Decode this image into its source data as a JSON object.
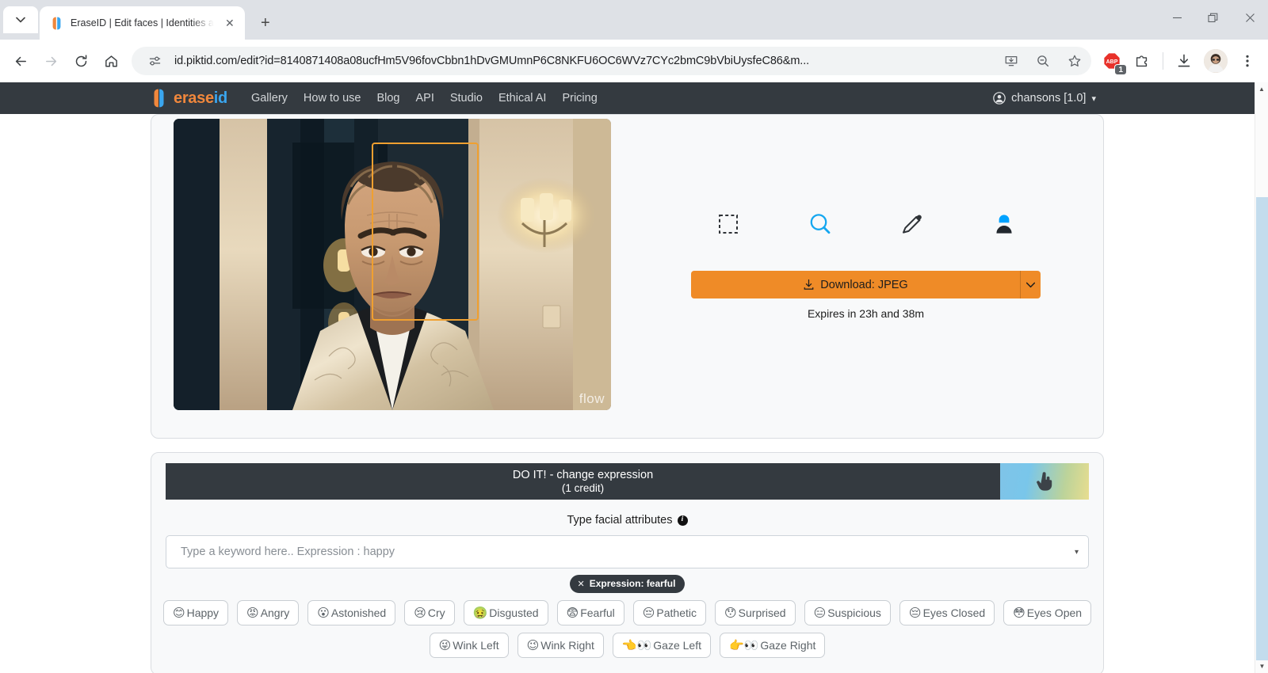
{
  "browser": {
    "tab": {
      "title": "EraseID | Edit faces | Identities a",
      "favicon": "eraseid-logo-icon",
      "close_label": "✕"
    },
    "new_tab_label": "+",
    "window": {
      "minimize": "—",
      "maximize": "❐",
      "close": "✕"
    },
    "nav": {
      "back": "back-arrow-icon",
      "forward": "forward-arrow-icon",
      "reload": "reload-icon",
      "home": "home-icon"
    },
    "omnibox": {
      "url": "id.piktid.com/edit?id=8140871408a08ucfHm5V96fovCbbn1hDvGMUmnP6C8NKFU6OC6WVz7CYc2bmC9bVbiUysfeC86&m...",
      "site_info": "tune-icon",
      "install": "install-app-icon",
      "zoom": "zoom-out-icon",
      "bookmark": "star-icon"
    },
    "extensions": {
      "adblock": "adblock-icon",
      "adblock_badge": "1",
      "puzzle": "extensions-icon",
      "downloads": "downloads-icon",
      "profile": "profile-avatar",
      "menu": "three-dot-menu-icon"
    }
  },
  "site_header": {
    "brand": {
      "prefix": "erase",
      "suffix": "id"
    },
    "nav_items": [
      "Gallery",
      "How to use",
      "Blog",
      "API",
      "Studio",
      "Ethical AI",
      "Pricing"
    ],
    "account": "chansons [1.0]",
    "account_caret": "▾"
  },
  "preview": {
    "watermark": "flow",
    "tools": [
      {
        "name": "select-region",
        "icon": "dashed-square-icon"
      },
      {
        "name": "zoom-search",
        "icon": "magnifier-icon"
      },
      {
        "name": "edit-pencil",
        "icon": "pencil-icon"
      },
      {
        "name": "identity-person",
        "icon": "person-icon"
      }
    ],
    "download_label": "Download: JPEG",
    "download_icon": "download-icon",
    "download_caret": "▾",
    "expires": "Expires in 23h and 38m"
  },
  "controls": {
    "doit_main": "DO IT! - change expression",
    "doit_sub": "(1 credit)",
    "doit_cursor_icon": "pointing-hand-icon",
    "attributes_label": "Type facial attributes",
    "info_icon": "i",
    "keyword_placeholder": "Type a keyword here.. Expression : happy",
    "keyword_value": "",
    "dropdown_caret": "▾",
    "active_chip": {
      "remove": "✕",
      "label": "Expression: fearful"
    },
    "pill_rows": [
      [
        {
          "emoji": "😊",
          "label": "Happy"
        },
        {
          "emoji": "😡",
          "label": "Angry"
        },
        {
          "emoji": "😮",
          "label": "Astonished"
        },
        {
          "emoji": "😢",
          "label": "Cry"
        },
        {
          "emoji": "🤢",
          "label": "Disgusted"
        },
        {
          "emoji": "😨",
          "label": "Fearful"
        },
        {
          "emoji": "😔",
          "label": "Pathetic"
        },
        {
          "emoji": "😯",
          "label": "Surprised"
        },
        {
          "emoji": "😑",
          "label": "Suspicious"
        },
        {
          "emoji": "😔",
          "label": "Eyes Closed"
        },
        {
          "emoji": "😳",
          "label": "Eyes Open"
        }
      ],
      [
        {
          "emoji": "😜",
          "label": "Wink Left"
        },
        {
          "emoji": "😉",
          "label": "Wink Right"
        },
        {
          "emoji": "👈👀",
          "label": "Gaze Left"
        },
        {
          "emoji": "👉👀",
          "label": "Gaze Right"
        }
      ]
    ]
  },
  "colors": {
    "accent_orange": "#ef8b27",
    "brand_orange": "#f0873c",
    "brand_blue": "#3aa6ef",
    "dark": "#343a40",
    "facebox": "#f0a030",
    "scrollbar_thumb": "#c3dced"
  },
  "scrollbar": {
    "up": "▲",
    "down": "▼"
  }
}
